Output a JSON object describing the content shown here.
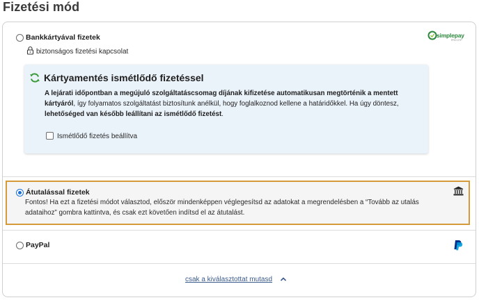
{
  "page": {
    "title": "Fizetési mód"
  },
  "options": {
    "card": {
      "label": "Bankkártyával fizetek",
      "secure_text": "biztonságos fizetési kapcsolat",
      "provider_logo": "simplepay",
      "provider_logo_sub": "PRO OTP"
    },
    "recurring": {
      "title": "Kártyamentés ismétlődő fizetéssel",
      "body_part1": "A lejárati időpontban a megújuló szolgáltatáscsomag díjának kifizetése automatikusan megtörténik a mentett kártyáról",
      "body_part2": ", így folyamatos szolgáltatást biztosítunk anélkül, hogy foglalkoznod kellene a határidőkkel. Ha úgy döntesz, ",
      "body_part3": "lehetőséged van később leállítani az ismétlődő fizetést",
      "body_part4": ".",
      "checkbox_label": "Ismétlődő fizetés beállítva",
      "checkbox_checked": false
    },
    "transfer": {
      "label": "Átutalással fizetek",
      "selected": true,
      "description": "Fontos! Ha ezt a fizetési módot választod, először mindenképpen véglegesítsd az adatokat a megrendelésben a “Tovább az utalás adataihoz” gombra kattintva, és csak ezt követően indítsd el az átutalást.",
      "icon": "bank-icon"
    },
    "paypal": {
      "label": "PayPal",
      "selected": false,
      "icon": "paypal-icon"
    }
  },
  "footer": {
    "link_label": "csak a kiválasztottat mutasd",
    "icon": "chevron-up-icon"
  },
  "colors": {
    "accent_blue": "#1a6fd6",
    "selected_border": "#d69a3a",
    "info_bg": "#eaf2fa",
    "simplepay_green": "#2d8a3e",
    "paypal_dark": "#003087",
    "paypal_light": "#009cde"
  }
}
